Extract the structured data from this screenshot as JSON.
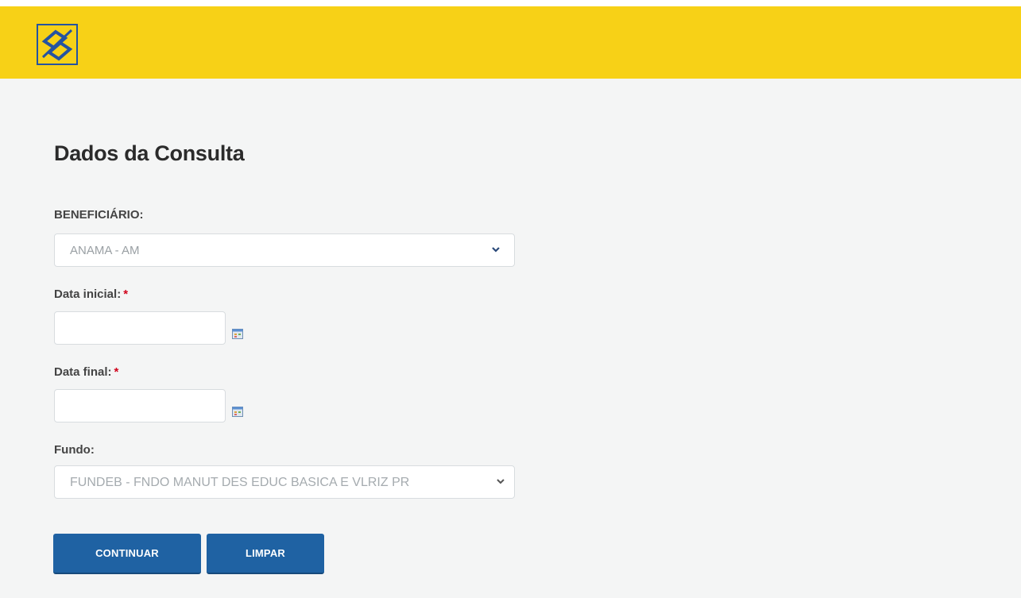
{
  "header": {
    "logo": "banco-do-brasil-logo",
    "colors": {
      "header_bg": "#f7d117",
      "logo_blue": "#2553a0"
    }
  },
  "form": {
    "title": "Dados da Consulta",
    "beneficiario": {
      "label": "BENEFICIÁRIO:",
      "value": "ANAMA - AM"
    },
    "data_inicial": {
      "label": "Data inicial:",
      "required_mark": "*",
      "value": ""
    },
    "data_final": {
      "label": "Data final:",
      "required_mark": "*",
      "value": ""
    },
    "fundo": {
      "label": "Fundo:",
      "value": "FUNDEB - FNDO MANUT DES EDUC BASICA E VLRIZ PR"
    }
  },
  "actions": {
    "continuar_label": "CONTINUAR",
    "limpar_label": "LIMPAR",
    "button_color": "#1f62a3"
  },
  "colors": {
    "page_bg": "#f4f5f5",
    "required": "#d0021b"
  }
}
